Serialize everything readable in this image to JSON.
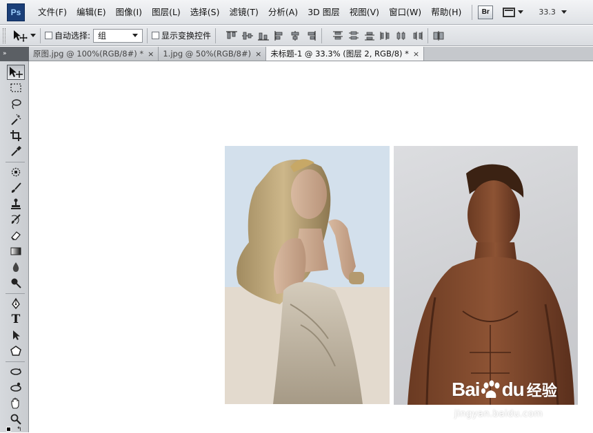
{
  "app": {
    "logo": "Ps"
  },
  "menu": {
    "items": [
      "文件(F)",
      "编辑(E)",
      "图像(I)",
      "图层(L)",
      "选择(S)",
      "滤镜(T)",
      "分析(A)",
      "3D 图层",
      "视图(V)",
      "窗口(W)",
      "帮助(H)"
    ],
    "bridge_label": "Br",
    "zoom_value": "33.3"
  },
  "options": {
    "auto_select_label": "自动选择:",
    "auto_select_value": "组",
    "show_transform_label": "显示变换控件"
  },
  "tabs": [
    {
      "label": "原图.jpg @ 100%(RGB/8#) *",
      "active": false
    },
    {
      "label": "1.jpg @ 50%(RGB/8#)",
      "active": false
    },
    {
      "label": "未标题-1 @ 33.3% (图层 2, RGB/8) *",
      "active": true
    }
  ],
  "tab_close_glyph": "×",
  "panel_toggle": "»",
  "toolbox": {
    "tools": [
      "move-tool",
      "marquee-tool",
      "lasso-tool",
      "magic-wand-tool",
      "crop-tool",
      "eyedropper-tool",
      "spot-healing-tool",
      "brush-tool",
      "clone-stamp-tool",
      "history-brush-tool",
      "eraser-tool",
      "gradient-tool",
      "blur-tool",
      "dodge-tool",
      "pen-tool",
      "type-tool",
      "path-selection-tool",
      "shape-tool",
      "3d-rotate-tool",
      "3d-orbit-tool",
      "hand-tool",
      "zoom-tool"
    ],
    "type_tool_glyph": "T"
  },
  "watermark": {
    "brand_left": "Bai",
    "brand_right": "du",
    "brand_cn": "经验",
    "url": "jingyan.baidu.com"
  }
}
